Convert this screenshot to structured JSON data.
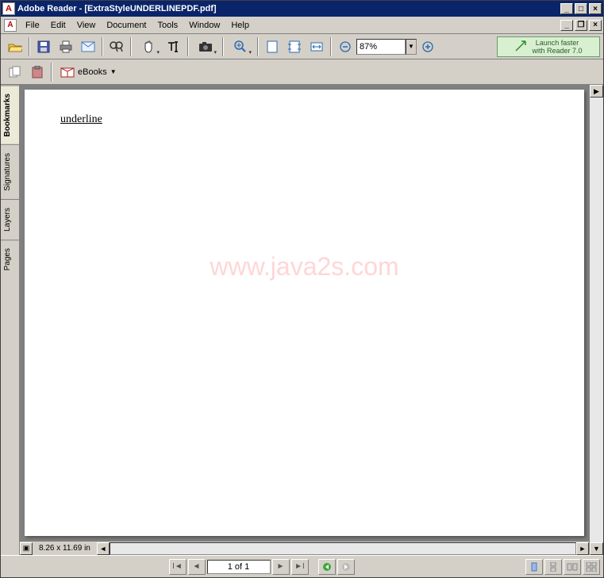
{
  "title": "Adobe Reader - [ExtraStyleUNDERLINEPDF.pdf]",
  "menu": [
    "File",
    "Edit",
    "View",
    "Document",
    "Tools",
    "Window",
    "Help"
  ],
  "zoom": "87%",
  "promo_line1": "Launch faster",
  "promo_line2": "with Reader 7.0",
  "ebooks_label": "eBooks",
  "side_tabs": [
    "Bookmarks",
    "Signatures",
    "Layers",
    "Pages"
  ],
  "document_text": "underline",
  "watermark": "www.java2s.com",
  "page_dims": "8.26 x 11.69 in",
  "page_indicator": "1 of 1"
}
